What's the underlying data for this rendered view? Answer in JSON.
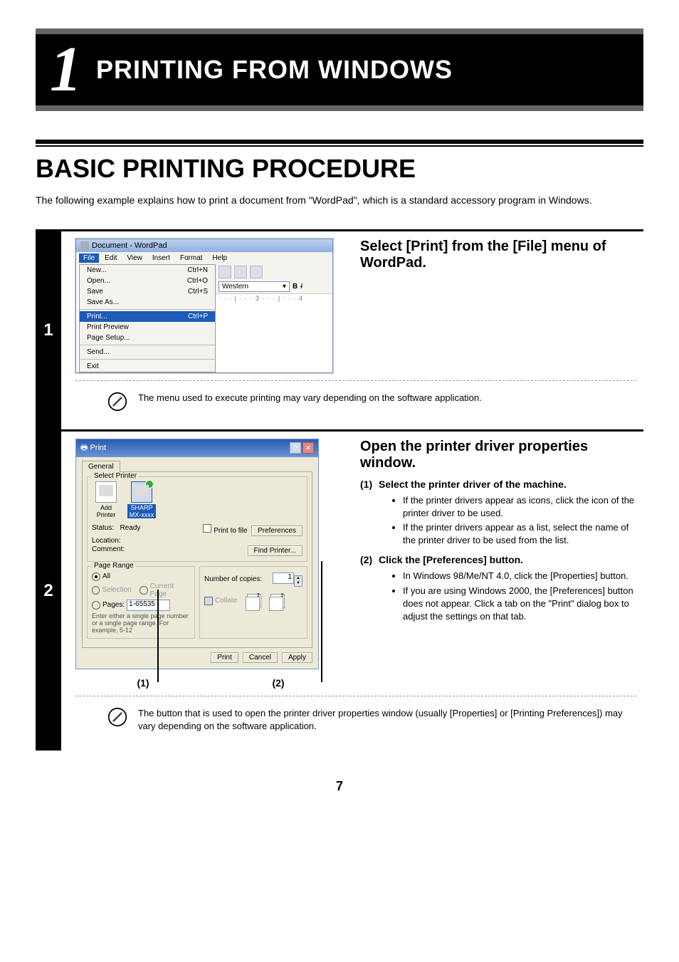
{
  "chapter": {
    "number": "1",
    "title": "PRINTING FROM WINDOWS"
  },
  "section_title": "BASIC PRINTING PROCEDURE",
  "intro": "The following example explains how to print a document from \"WordPad\", which is a standard accessory program in Windows.",
  "step1": {
    "num": "1",
    "heading": "Select [Print] from the [File] menu of WordPad.",
    "note": "The menu used to execute printing may vary depending on the software application.",
    "wordpad": {
      "title": "Document - WordPad",
      "menu": {
        "file": "File",
        "edit": "Edit",
        "view": "View",
        "insert": "Insert",
        "format": "Format",
        "help": "Help"
      },
      "items": {
        "new": "New...",
        "new_sc": "Ctrl+N",
        "open": "Open...",
        "open_sc": "Ctrl+O",
        "save": "Save",
        "save_sc": "Ctrl+S",
        "saveas": "Save As...",
        "print": "Print...",
        "print_sc": "Ctrl+P",
        "preview": "Print Preview",
        "pagesetup": "Page Setup...",
        "send": "Send...",
        "exit": "Exit"
      },
      "font_name": "Western",
      "ruler": "· · · | · · · 3 · · · | · · · 4",
      "bold": "B",
      "italic": "I"
    }
  },
  "step2": {
    "num": "2",
    "heading": "Open the printer driver properties window.",
    "sub1_num": "(1)",
    "sub1_title": "Select the printer driver of the machine.",
    "sub1_bullets": [
      "If the printer drivers appear as icons, click the icon of the printer driver to be used.",
      "If the printer drivers appear as a list, select the name of the printer driver to be used from the list."
    ],
    "sub2_num": "(2)",
    "sub2_title": "Click the [Preferences] button.",
    "sub2_bullets": [
      "In Windows 98/Me/NT 4.0, click the [Properties] button.",
      "If you are using Windows 2000, the [Preferences] button does not appear. Click a tab on the \"Print\" dialog box to adjust the settings on that tab."
    ],
    "note": "The button that is used to open the printer driver properties window (usually [Properties] or [Printing Preferences]) may vary depending on the software application.",
    "callout1": "(1)",
    "callout2": "(2)",
    "dialog": {
      "title": "Print",
      "tab": "General",
      "group_printer": "Select Printer",
      "add_printer": "Add Printer",
      "sharp": "SHARP\nMX-xxxx",
      "status_lbl": "Status:",
      "status_val": "Ready",
      "location_lbl": "Location:",
      "comment_lbl": "Comment:",
      "print_to_file": "Print to file",
      "preferences_btn": "Preferences",
      "find_btn": "Find Printer...",
      "group_range": "Page Range",
      "all": "All",
      "selection": "Selection",
      "current": "Current Page",
      "pages": "Pages:",
      "pages_val": "1-65535",
      "pages_hint": "Enter either a single page number or a single page range. For example, 5-12",
      "copies_lbl": "Number of copies:",
      "copies_val": "1",
      "collate": "Collate",
      "print_btn": "Print",
      "cancel_btn": "Cancel",
      "apply_btn": "Apply"
    }
  },
  "page_number": "7"
}
